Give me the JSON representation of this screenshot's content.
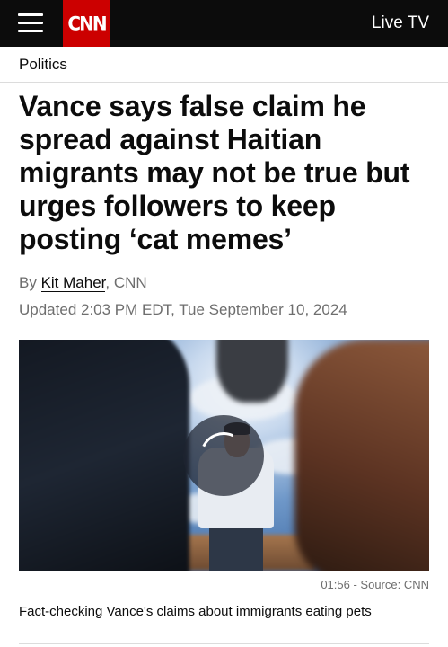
{
  "header": {
    "menu_icon": "hamburger-menu-icon",
    "logo_text": "CNN",
    "live_tv_label": "Live TV",
    "brand_color": "#cc0000",
    "bar_color": "#0c0c0c"
  },
  "article": {
    "section": "Politics",
    "headline": "Vance says false claim he spread against Haitian migrants may not be true but urges followers to keep posting ‘cat memes’",
    "byline_prefix": "By ",
    "author": "Kit Maher",
    "byline_suffix": ", CNN",
    "updated": "Updated 2:03 PM EDT, Tue September 10, 2024"
  },
  "video": {
    "state_icon": "loading-spinner-icon",
    "duration_source": "01:56 - Source: CNN",
    "caption": "Fact-checking Vance's claims about immigrants eating pets"
  }
}
